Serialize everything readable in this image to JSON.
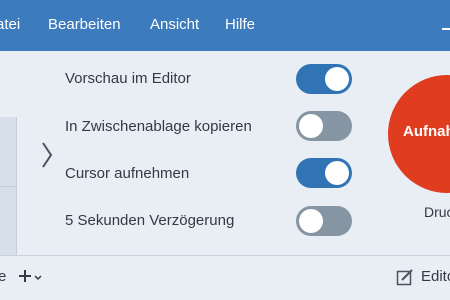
{
  "menu": {
    "items": [
      {
        "label": "Datei",
        "visible_text": "atei"
      },
      {
        "label": "Bearbeiten"
      },
      {
        "label": "Ansicht"
      },
      {
        "label": "Hilfe"
      }
    ]
  },
  "options": [
    {
      "label": "Vorschau im Editor",
      "state": "on"
    },
    {
      "label": "In Zwischenablage kopieren",
      "state": "off"
    },
    {
      "label": "Cursor aufnehmen",
      "state": "on"
    },
    {
      "label": "5 Sekunden Verzögerung",
      "state": "off"
    }
  ],
  "capture": {
    "button_label": "Aufnahme",
    "shortcut_label": "Druck"
  },
  "bottom": {
    "left_text": "e",
    "add_label": "+",
    "edit_label": "Editor"
  },
  "colors": {
    "menubar": "#3c7bbd",
    "toggle_on": "#3174b5",
    "toggle_off": "#8695a3",
    "record": "#e03c1f",
    "background": "#e8eef4"
  }
}
